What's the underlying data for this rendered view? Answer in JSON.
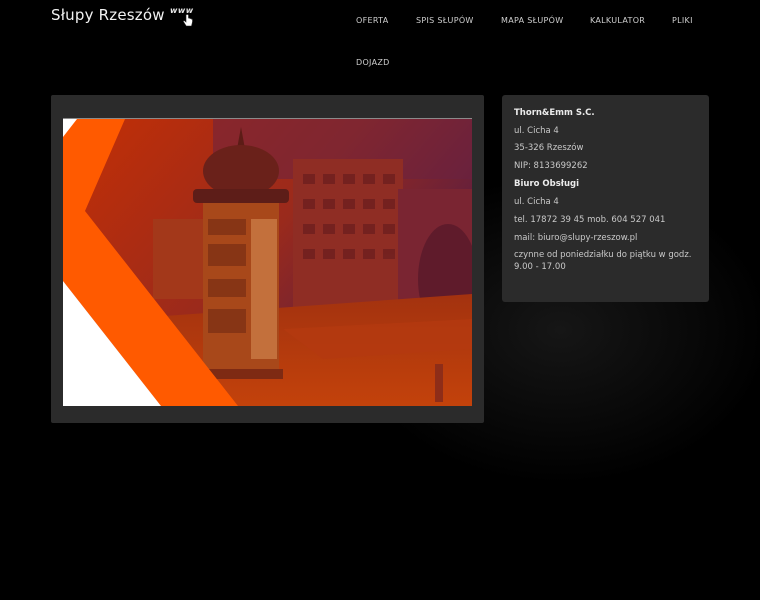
{
  "header": {
    "site_title": "Słupy Rzeszów",
    "logo_text": "www",
    "logo_icon": "hand-cursor-icon"
  },
  "nav": {
    "items": [
      {
        "label": "OFERTA"
      },
      {
        "label": "SPIS SŁUPÓW"
      },
      {
        "label": "MAPA SŁUPÓW"
      },
      {
        "label": "KALKULATOR"
      },
      {
        "label": "PLIKI"
      },
      {
        "label": "DOJAZD"
      }
    ]
  },
  "contact": {
    "company": "Thorn&Emm S.C.",
    "street": "ul. Cicha 4",
    "city": "35-326 Rzeszów",
    "nip": "NIP: 8133699262",
    "office_heading": "Biuro Obsługi",
    "office_street": "ul. Cicha 4",
    "phone": "tel. 17872 39 45 mob. 604 527 041",
    "mail": "mail: biuro@slupy-rzeszow.pl",
    "hours": "czynne od poniedziałku do piątku w godz. 9.00 - 17.00"
  },
  "colors": {
    "background": "#000000",
    "panel": "#2b2b2b",
    "accent_orange": "#ff5a00"
  }
}
